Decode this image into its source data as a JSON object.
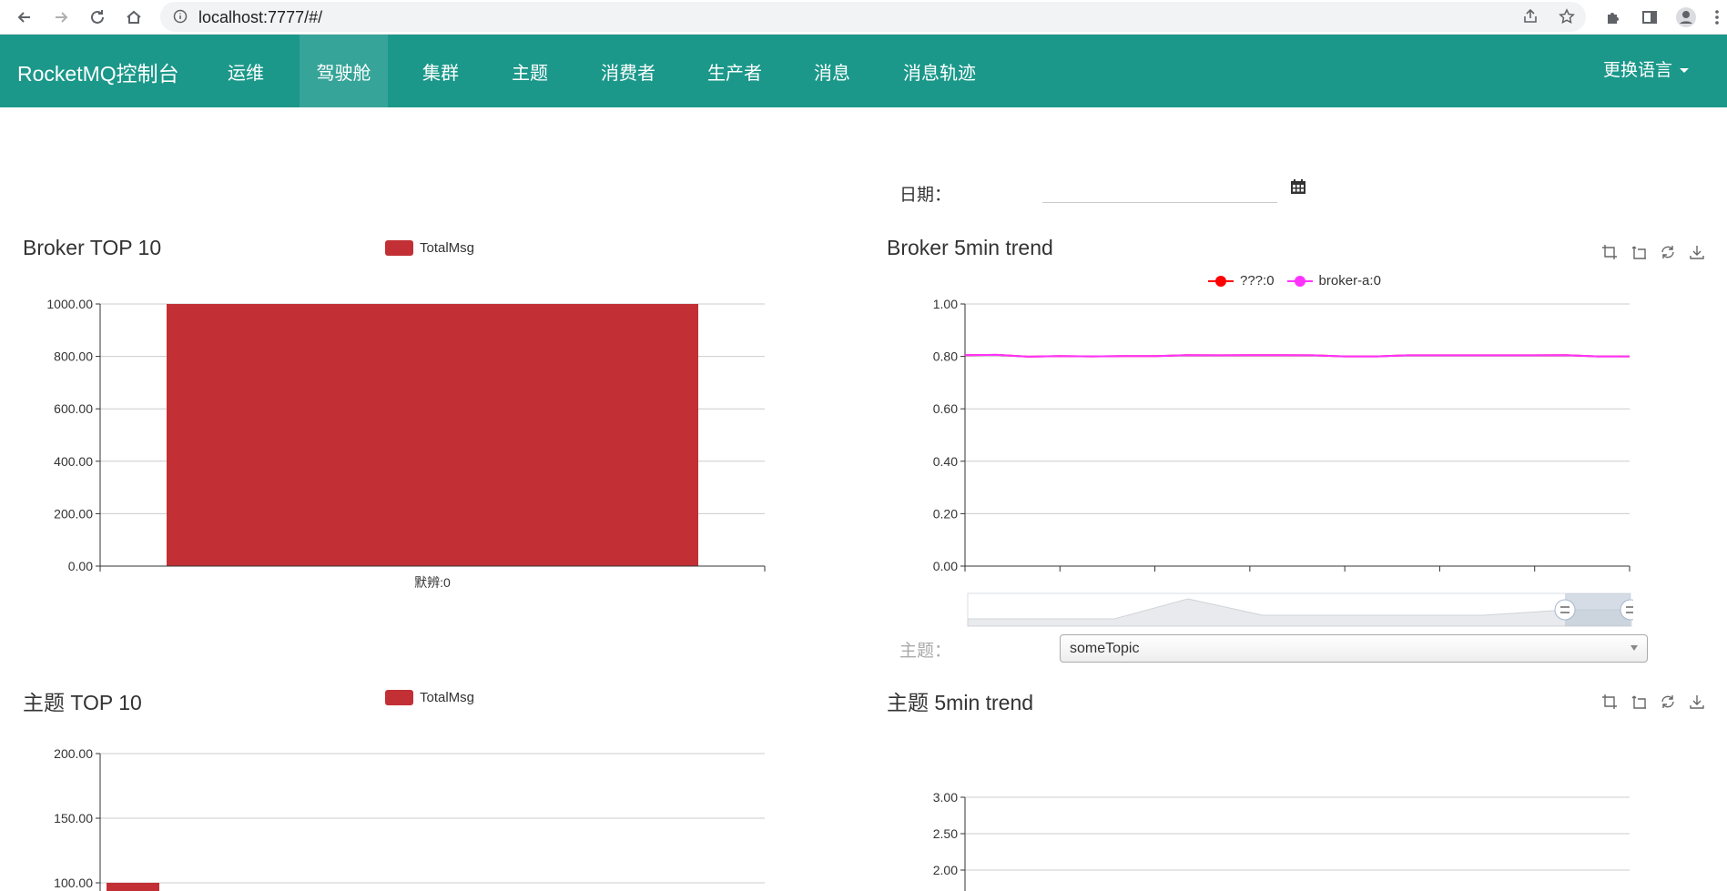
{
  "browser": {
    "url": "localhost:7777/#/"
  },
  "navbar": {
    "brand": "RocketMQ控制台",
    "items": [
      {
        "label": "运维"
      },
      {
        "label": "驾驶舱"
      },
      {
        "label": "集群"
      },
      {
        "label": "主题"
      },
      {
        "label": "消费者"
      },
      {
        "label": "生产者"
      },
      {
        "label": "消息"
      },
      {
        "label": "消息轨迹"
      }
    ],
    "active_index": 1,
    "language": "更换语言"
  },
  "filters": {
    "date_label": "日期：",
    "date_value": "",
    "topic_label": "主题：",
    "topic_selected": "someTopic"
  },
  "colors": {
    "navbar": "#1b988a",
    "bar": "#c23035",
    "series_red": "#ff0000",
    "series_magenta": "#ff33ff"
  },
  "chart_data": [
    {
      "id": "broker-top10",
      "type": "bar",
      "title": "Broker TOP 10",
      "legend": [
        "TotalMsg"
      ],
      "categories": [
        "默辨:0"
      ],
      "series": [
        {
          "name": "TotalMsg",
          "values": [
            1000
          ]
        }
      ],
      "ylim": [
        0,
        1000
      ],
      "yticks": [
        "0.00",
        "200.00",
        "400.00",
        "600.00",
        "800.00",
        "1000.00"
      ]
    },
    {
      "id": "broker-5min-trend",
      "type": "line",
      "title": "Broker 5min trend",
      "legend": [
        "???:0",
        "broker-a:0"
      ],
      "ylim": [
        0,
        1
      ],
      "yticks": [
        "0.00",
        "0.20",
        "0.40",
        "0.60",
        "0.80",
        "1.00"
      ],
      "series": [
        {
          "name": "???:0",
          "values": [
            0.805,
            0.806,
            0.799,
            0.801,
            0.8,
            0.801,
            0.801,
            0.805,
            0.804,
            0.805,
            0.805,
            0.804,
            0.8,
            0.8,
            0.804,
            0.804,
            0.804,
            0.804,
            0.804,
            0.805,
            0.8,
            0.8
          ]
        },
        {
          "name": "broker-a:0",
          "values": [
            0.805,
            0.806,
            0.799,
            0.801,
            0.8,
            0.801,
            0.801,
            0.805,
            0.804,
            0.805,
            0.805,
            0.804,
            0.8,
            0.8,
            0.804,
            0.804,
            0.804,
            0.804,
            0.804,
            0.805,
            0.8,
            0.8
          ]
        }
      ],
      "toolbox": [
        "data-zoom-icon",
        "zoom-reset-icon",
        "restore-icon",
        "save-image-icon"
      ]
    },
    {
      "id": "topic-top10",
      "type": "bar",
      "title": "主题 TOP 10",
      "legend": [
        "TotalMsg"
      ],
      "categories": [
        ""
      ],
      "series": [
        {
          "name": "TotalMsg",
          "values": [
            100
          ]
        }
      ],
      "ylim": [
        0,
        200
      ],
      "yticks": [
        "100.00",
        "150.00",
        "200.00"
      ]
    },
    {
      "id": "topic-5min-trend",
      "type": "line",
      "title": "主题 5min trend",
      "yticks": [
        "2.00",
        "2.50",
        "3.00"
      ],
      "series": [],
      "toolbox": [
        "data-zoom-icon",
        "zoom-reset-icon",
        "restore-icon",
        "save-image-icon"
      ]
    }
  ]
}
